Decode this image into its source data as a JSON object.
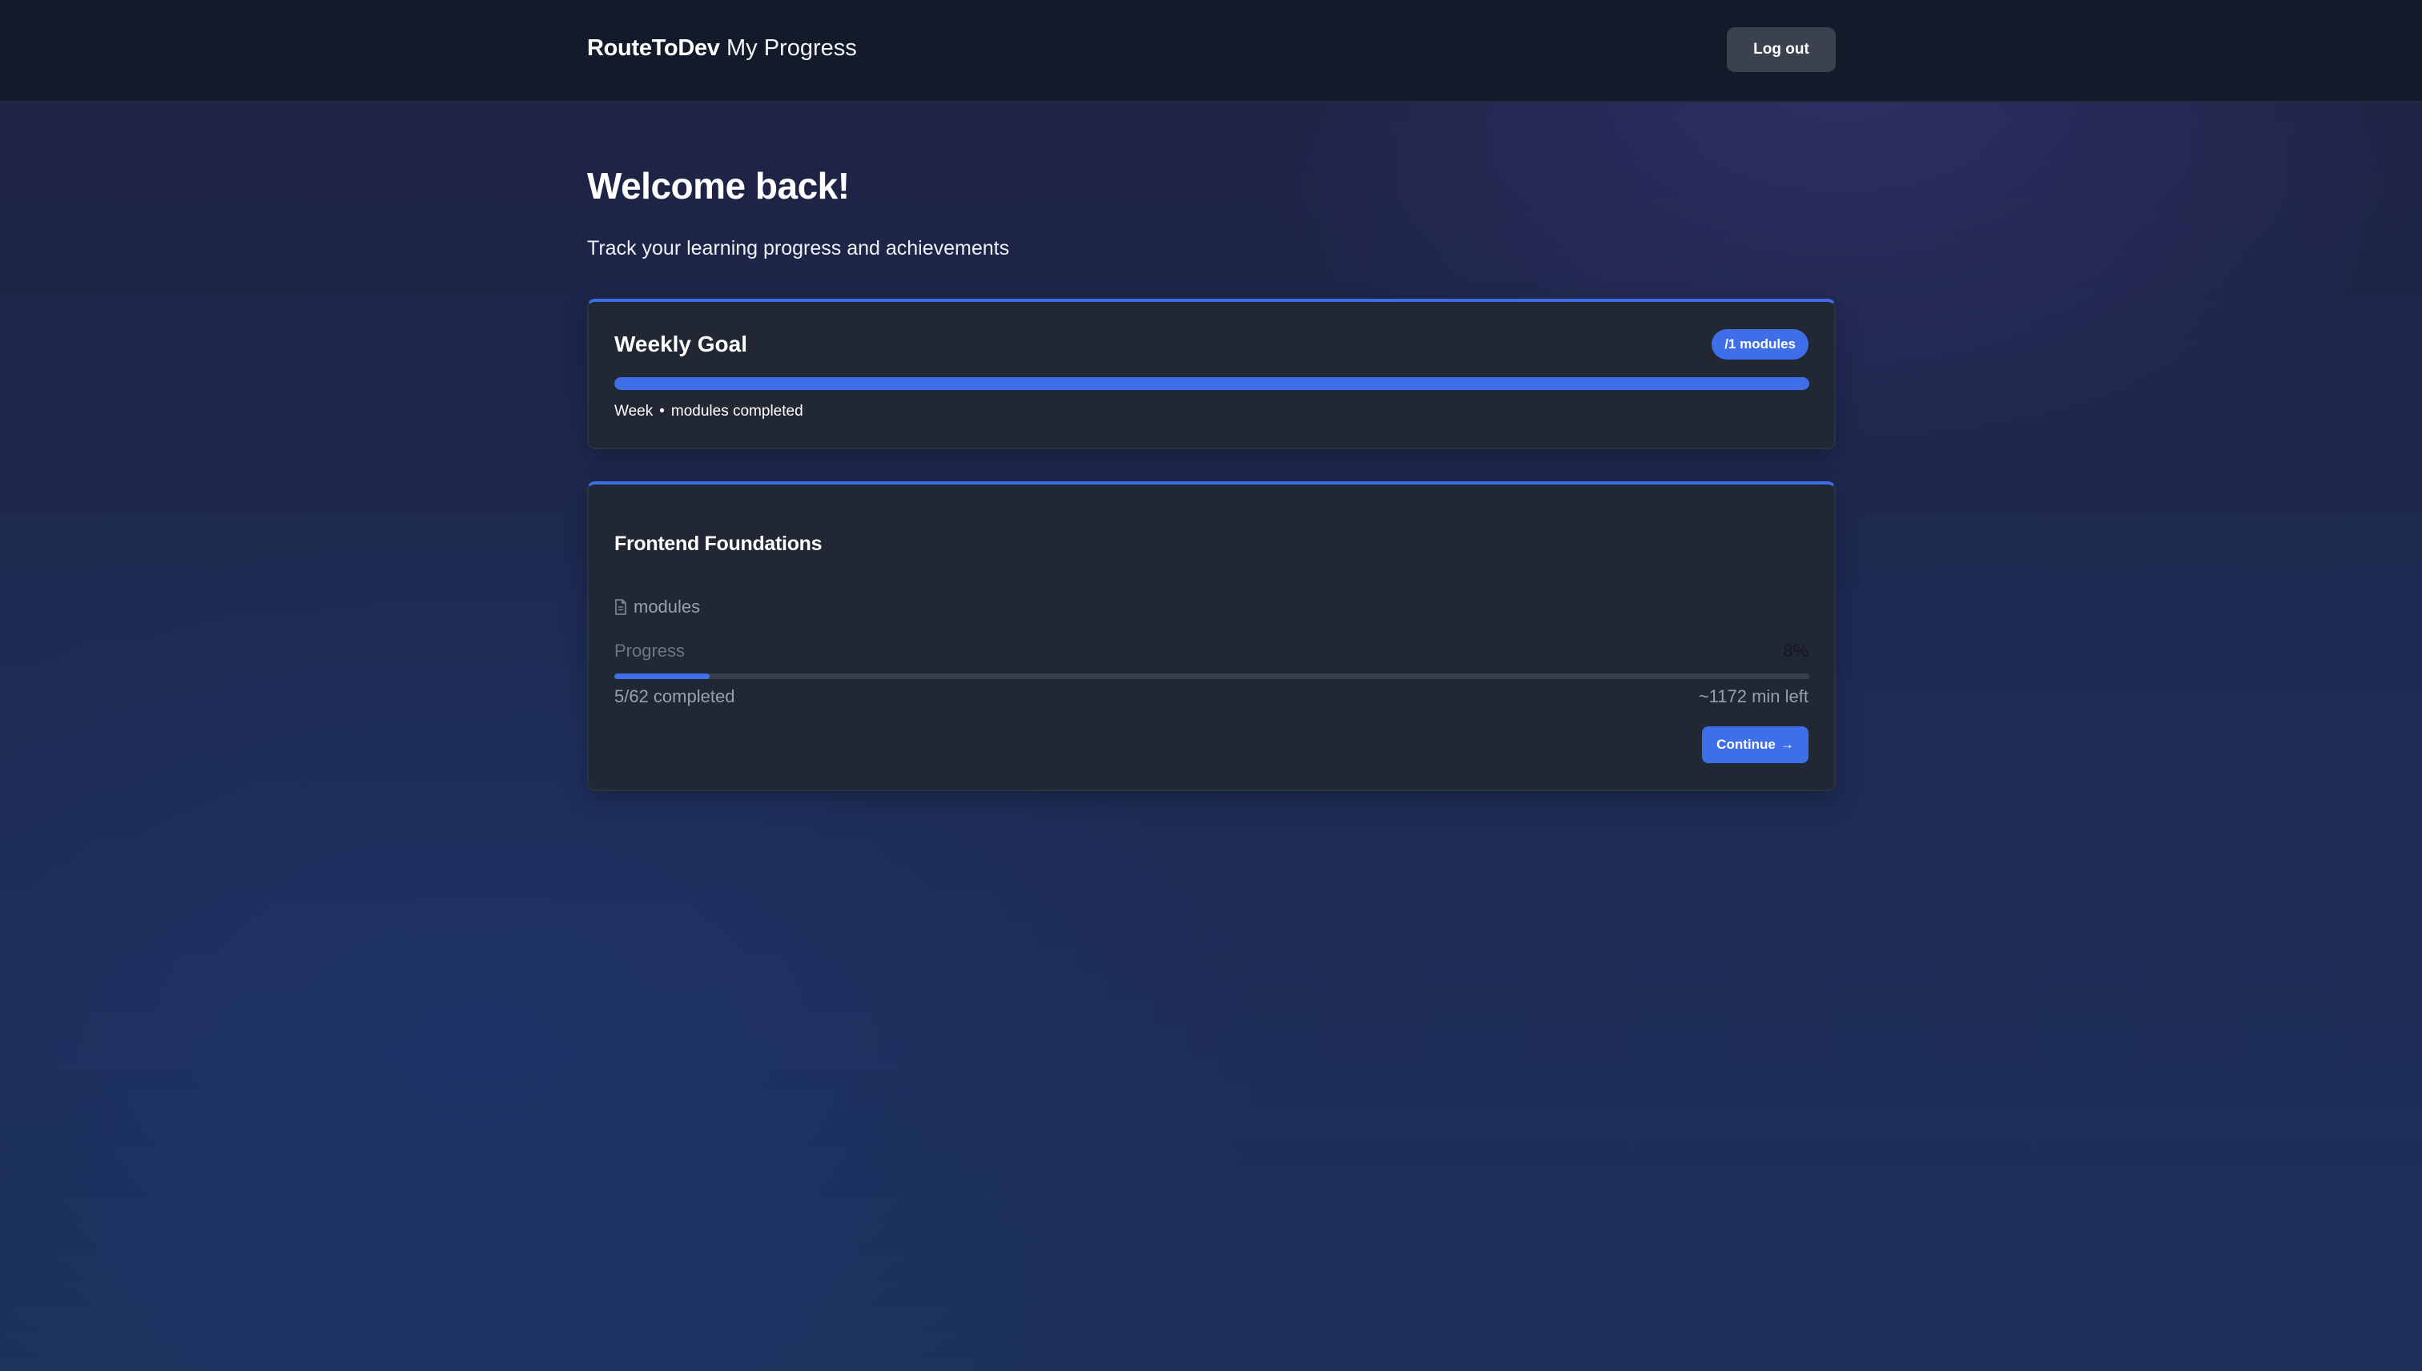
{
  "header": {
    "brand": "RouteToDev",
    "page_title": "My Progress",
    "logout_label": "Log out"
  },
  "main": {
    "welcome": "Welcome back!",
    "subtitle": "Track your learning progress and achievements"
  },
  "weekly_goal": {
    "title": "Weekly Goal",
    "badge": "/1 modules",
    "progress_fraction": 1.0,
    "caption_week": "Week",
    "caption_separator": "•",
    "caption_modules": "modules completed"
  },
  "course": {
    "title": "Frontend Foundations",
    "modules_label": "modules",
    "modules_icon": "document-icon",
    "progress_label": "Progress",
    "progress_percent_text": "8%",
    "progress_fraction": 0.08,
    "completed_text": "5/62 completed",
    "time_left_text": "~1172 min left",
    "continue_label": "Continue",
    "continue_arrow": "→"
  },
  "colors": {
    "accent": "#3f6fe8",
    "topbar": "#131a2a",
    "card": "#212733",
    "logout_button": "#3b414d"
  }
}
